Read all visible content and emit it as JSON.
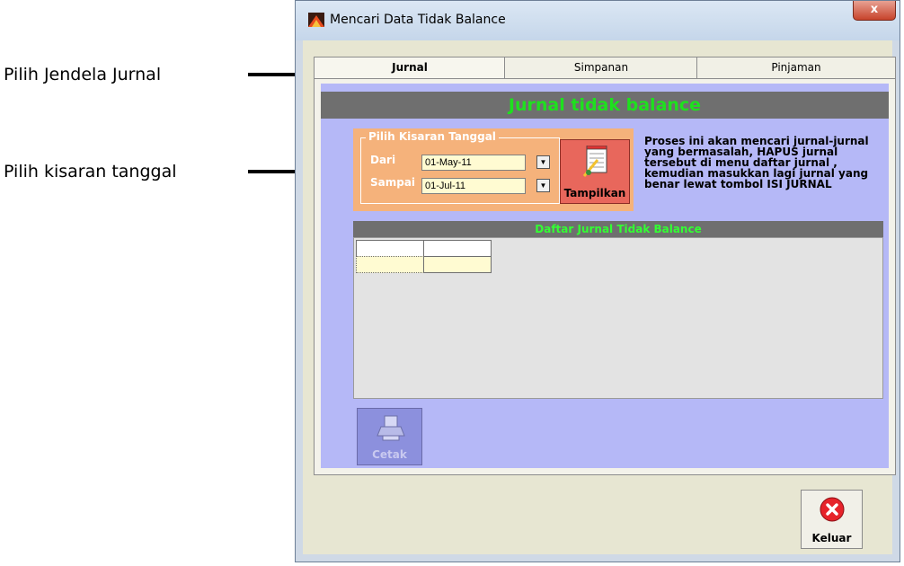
{
  "annotations": {
    "pick_window": "Pilih Jendela Jurnal",
    "pick_range": "Pilih kisaran tanggal"
  },
  "window": {
    "title": "Mencari Data Tidak Balance",
    "close_label": "x"
  },
  "tabs": [
    {
      "label": "Jurnal",
      "active": true
    },
    {
      "label": "Simpanan",
      "active": false
    },
    {
      "label": "Pinjaman",
      "active": false
    }
  ],
  "panel": {
    "header": "Jurnal tidak balance",
    "group_title": "Pilih Kisaran Tanggal",
    "from_label": "Dari",
    "from_value": "01-May-11",
    "to_label": "Sampai",
    "to_value": "01-Jul-11",
    "show_button": "Tampilkan",
    "info_text": "Proses ini akan mencari jurnal-jurnal yang bermasalah, HAPUS jurnal tersebut di menu daftar jurnal , kemudian masukkan lagi jurnal yang benar lewat tombol ISI JURNAL",
    "grid_title": "Daftar Jurnal Tidak Balance",
    "print_button": "Cetak"
  },
  "footer": {
    "exit_button": "Keluar"
  },
  "colors": {
    "panel_bg": "#b5b8f7",
    "header_bg": "#6f6f6f",
    "header_text": "#1ee11e",
    "date_group_bg": "#f5b27b",
    "show_button_bg": "#e8675c",
    "exit_icon": "#e6232a"
  }
}
